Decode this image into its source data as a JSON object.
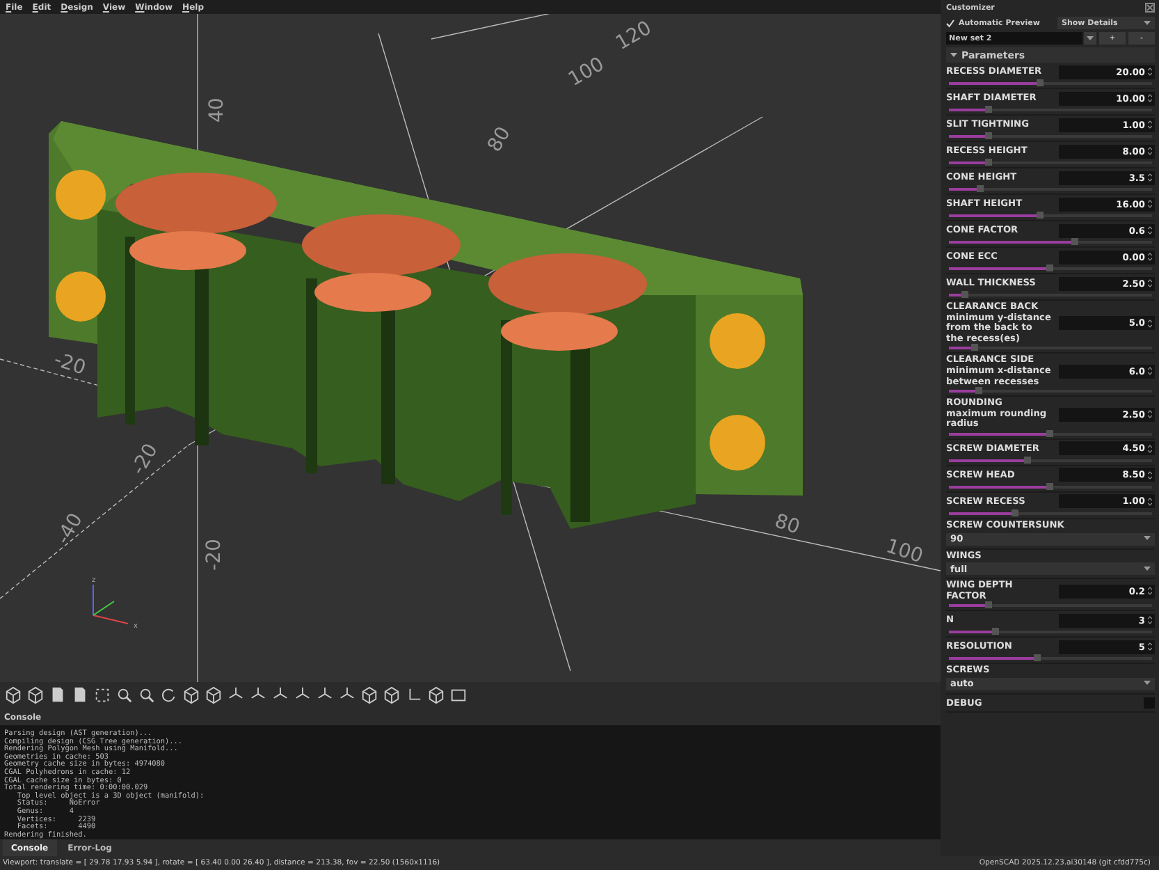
{
  "menu": [
    "File",
    "Edit",
    "Design",
    "View",
    "Window",
    "Help"
  ],
  "viewport": {
    "axis_labels": [
      "40",
      "80",
      "100",
      "120",
      "-20",
      "-20",
      "-40",
      "80",
      "100",
      "-20"
    ],
    "gizmo_labels": [
      "z",
      "x"
    ]
  },
  "console": {
    "title": "Console",
    "lines": [
      "Parsing design (AST generation)...",
      "Compiling design (CSG Tree generation)...",
      "Rendering Polygon Mesh using Manifold...",
      "Geometries in cache: 503",
      "Geometry cache size in bytes: 4974080",
      "CGAL Polyhedrons in cache: 12",
      "CGAL cache size in bytes: 0",
      "Total rendering time: 0:00:00.029",
      "   Top level object is a 3D object (manifold):",
      "   Status:     NoError",
      "   Genus:      4",
      "   Vertices:     2239",
      "   Facets:       4490",
      "Rendering finished."
    ],
    "tabs": [
      {
        "label": "Console",
        "selected": true
      },
      {
        "label": "Error-Log",
        "selected": false
      }
    ]
  },
  "status_bar": {
    "viewport": "Viewport: translate = [ 29.78 17.93 5.94 ], rotate = [ 63.40 0.00 26.40 ], distance = 213.38, fov = 22.50 (1560x1116)",
    "version": "OpenSCAD 2025.12.23.ai30148 (git cfdd775c)"
  },
  "customizer": {
    "title": "Customizer",
    "automatic_preview": {
      "label": "Automatic Preview",
      "checked": true
    },
    "details": "Show Details",
    "preset": "New set 2",
    "preset_buttons": [
      "+",
      "-"
    ],
    "section": {
      "title": "Parameters",
      "expanded": true
    },
    "parameters": [
      {
        "kind": "number",
        "label": "RECESS DIAMETER",
        "value": "20.00",
        "level": 0.45
      },
      {
        "kind": "number",
        "label": "SHAFT DIAMETER",
        "value": "10.00",
        "level": 0.2
      },
      {
        "kind": "number",
        "label": "SLIT TIGHTNING",
        "value": "1.00",
        "level": 0.2
      },
      {
        "kind": "number",
        "label": "RECESS HEIGHT",
        "value": "8.00",
        "level": 0.2
      },
      {
        "kind": "number",
        "label": "CONE HEIGHT",
        "value": "3.5",
        "level": 0.16
      },
      {
        "kind": "number",
        "label": "SHAFT HEIGHT",
        "value": "16.00",
        "level": 0.45
      },
      {
        "kind": "number",
        "label": "CONE FACTOR",
        "value": "0.6",
        "level": 0.62
      },
      {
        "kind": "number",
        "label": "CONE ECC",
        "value": "0.00",
        "level": 0.5
      },
      {
        "kind": "number",
        "label": "WALL THICKNESS",
        "value": "2.50",
        "level": 0.08
      },
      {
        "kind": "number",
        "label": "CLEARANCE BACK",
        "description": "minimum y-distance from the back to the recess(es)",
        "value": "5.0",
        "level": 0.13
      },
      {
        "kind": "number",
        "label": "CLEARANCE SIDE",
        "description": "minimum x-distance between recesses",
        "value": "6.0",
        "level": 0.15
      },
      {
        "kind": "number",
        "label": "ROUNDING",
        "description": "maximum rounding radius",
        "value": "2.50",
        "level": 0.5
      },
      {
        "kind": "number",
        "label": "SCREW DIAMETER",
        "value": "4.50",
        "level": 0.39
      },
      {
        "kind": "number",
        "label": "SCREW HEAD",
        "value": "8.50",
        "level": 0.5
      },
      {
        "kind": "number",
        "label": "SCREW RECESS",
        "value": "1.00",
        "level": 0.33
      },
      {
        "kind": "select",
        "label": "SCREW COUNTERSUNK",
        "value": "90"
      },
      {
        "kind": "select",
        "label": "WINGS",
        "value": "full"
      },
      {
        "kind": "number",
        "label": "WING DEPTH FACTOR",
        "value": "0.2",
        "level": 0.2
      },
      {
        "kind": "number",
        "label": "N",
        "value": "3",
        "level": 0.23
      },
      {
        "kind": "number",
        "label": "RESOLUTION",
        "value": "5",
        "level": 0.44
      },
      {
        "kind": "select",
        "label": "SCREWS",
        "value": "auto"
      },
      {
        "kind": "checkbox",
        "label": "DEBUG",
        "checked": false
      }
    ]
  }
}
